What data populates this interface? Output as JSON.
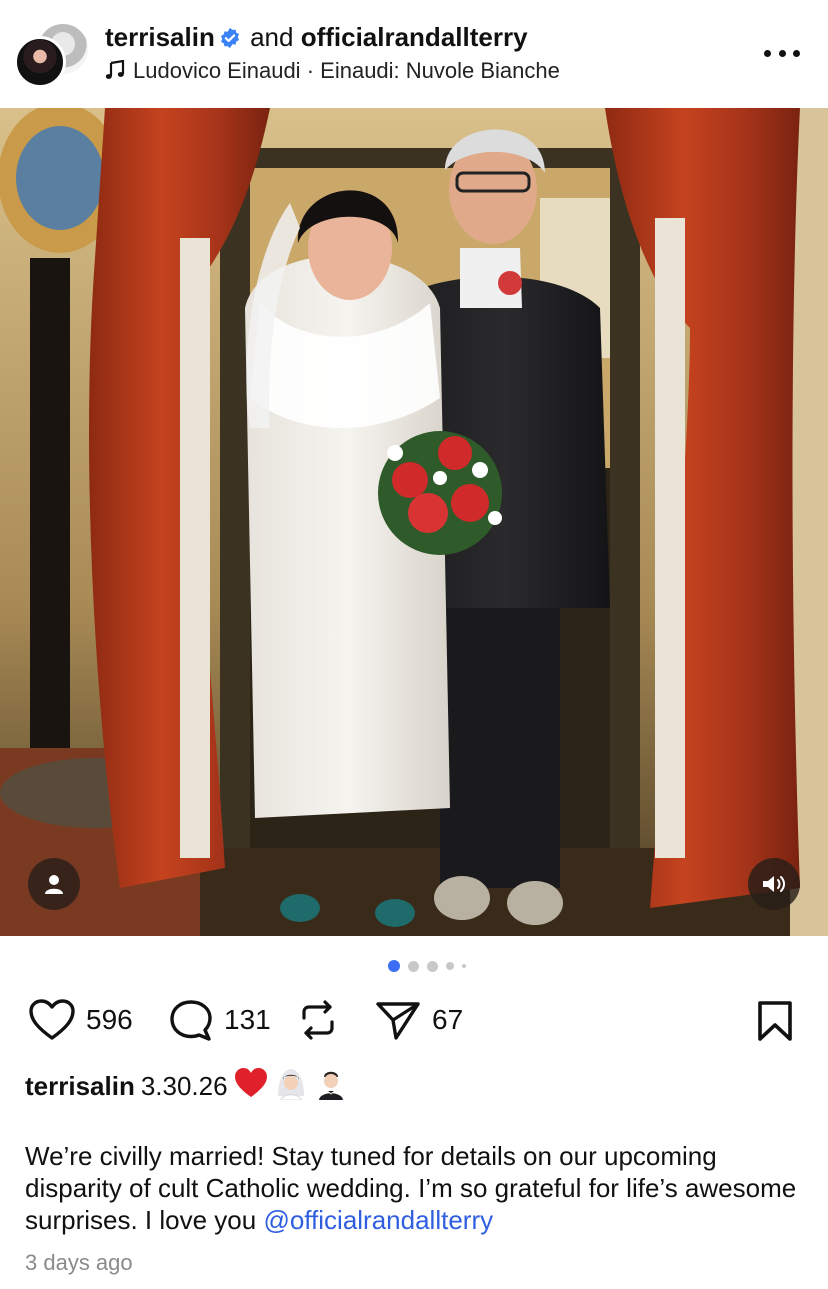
{
  "header": {
    "author": "terrisalin",
    "connector": "and",
    "coauthor": "officialrandallterry",
    "music_artist": "Ludovico Einaudi",
    "music_separator": "·",
    "music_track": "Einaudi: Nuvole Bianche"
  },
  "media": {
    "carousel_count": 5,
    "active_index": 0
  },
  "actions": {
    "likes": "596",
    "comments": "131",
    "shares": "67"
  },
  "caption": {
    "username": "terrisalin",
    "date_text": "3.30.26",
    "body": "We’re civilly married! Stay tuned for details on our upcoming disparity of cult Catholic wedding. I’m so grateful for life’s awesome surprises. I love you ",
    "mention": "@officialrandallterry",
    "timestamp": "3 days ago"
  },
  "colors": {
    "accent": "#3b6ef5",
    "mention": "#2f5fe0",
    "verified": "#3b82f6",
    "heart": "#e0202a"
  }
}
